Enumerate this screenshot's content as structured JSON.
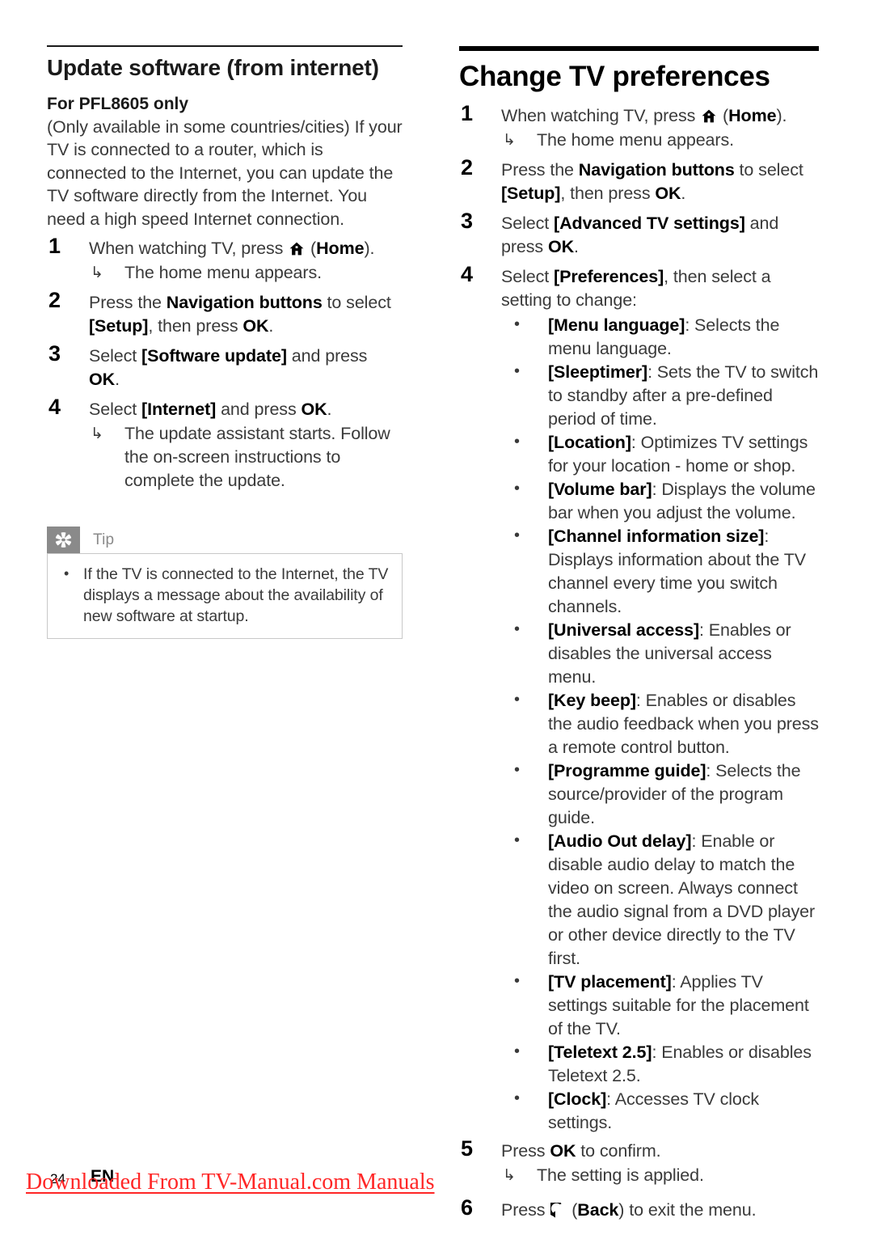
{
  "footer": {
    "page_number": "24",
    "language_code": "EN",
    "watermark": "Downloaded From TV-Manual.com Manuals",
    "watermark_color": "#ff2626"
  },
  "left_column": {
    "section_title": "Update software (from internet)",
    "sub_title": "For PFL8605 only",
    "intro": "(Only available in some countries/cities) If your TV is connected to a router, which is connected to the Internet, you can update the TV software directly from the Internet. You need a high speed Internet connection.",
    "steps": [
      {
        "num": "1",
        "pre": "When watching TV, press ",
        "icon": "home-icon",
        "post_open": " (",
        "bold": "Home",
        "post_close": ").",
        "result": "The home menu appears."
      },
      {
        "num": "2",
        "t1": "Press the ",
        "b1": "Navigation buttons",
        "t2": " to select ",
        "b2": "[Setup]",
        "t3": ", then press ",
        "b3": "OK",
        "t4": "."
      },
      {
        "num": "3",
        "t1": "Select ",
        "b1": "[Software update]",
        "t2": " and press ",
        "b2": "OK",
        "t3": "."
      },
      {
        "num": "4",
        "t1": "Select ",
        "b1": "[Internet]",
        "t2": " and press ",
        "b2": "OK",
        "t3": ".",
        "result": "The update assistant starts. Follow the on-screen instructions to complete the update."
      }
    ],
    "tip": {
      "icon": "asterisk-icon",
      "label": "Tip",
      "items": [
        "If the TV is connected to the Internet, the TV displays a message about the availability of new software at startup."
      ],
      "header_color": "#8a8a8a"
    }
  },
  "right_column": {
    "section_title": "Change TV preferences",
    "steps": [
      {
        "num": "1",
        "pre": "When watching TV, press ",
        "icon": "home-icon",
        "post_open": " (",
        "bold": "Home",
        "post_close": ").",
        "result": "The home menu appears."
      },
      {
        "num": "2",
        "t1": "Press the ",
        "b1": "Navigation buttons",
        "t2": " to select ",
        "b2": "[Setup]",
        "t3": ", then press ",
        "b3": "OK",
        "t4": "."
      },
      {
        "num": "3",
        "t1": "Select ",
        "b1": "[Advanced TV settings]",
        "t2": " and press ",
        "b2": "OK",
        "t3": "."
      },
      {
        "num": "4",
        "t1": "Select ",
        "b1": "[Preferences]",
        "t2": ", then select a setting to change:",
        "b2": "",
        "t3": ""
      },
      {
        "num": "5",
        "t1": "Press ",
        "b1": "OK",
        "t2": " to confirm.",
        "b2": "",
        "t3": "",
        "result": "The setting is applied."
      },
      {
        "num": "6",
        "pre": "Press ",
        "icon": "back-icon",
        "post_open": " (",
        "bold": "Back",
        "post_close": ") to exit the menu."
      }
    ],
    "preferences": [
      {
        "term": "[Menu language]",
        "desc": ": Selects the menu language."
      },
      {
        "term": "[Sleeptimer]",
        "desc": ": Sets the TV to switch to standby after a pre-defined period of time."
      },
      {
        "term": "[Location]",
        "desc": ": Optimizes TV settings for your location - home or shop."
      },
      {
        "term": "[Volume bar]",
        "desc": ": Displays the volume bar when you adjust the volume."
      },
      {
        "term": "[Channel information size]",
        "desc": ": Displays information about the TV channel every time you switch channels."
      },
      {
        "term": "[Universal access]",
        "desc": ": Enables or disables the universal access menu."
      },
      {
        "term": "[Key beep]",
        "desc": ": Enables or disables the audio feedback when you press a remote control button."
      },
      {
        "term": "[Programme guide]",
        "desc": ": Selects the source/provider of the program guide."
      },
      {
        "term": "[Audio Out delay]",
        "desc": ": Enable or disable audio delay to match the video on screen. Always connect the audio signal from a DVD player or other device directly to the TV first."
      },
      {
        "term": "[TV placement]",
        "desc": ": Applies TV settings suitable for the placement of the TV."
      },
      {
        "term": "[Teletext 2.5]",
        "desc": ": Enables or disables Teletext 2.5."
      },
      {
        "term": "[Clock]",
        "desc": ": Accesses TV clock settings."
      }
    ]
  },
  "glyphs": {
    "arrow_result": "↳",
    "bullet": "•"
  }
}
